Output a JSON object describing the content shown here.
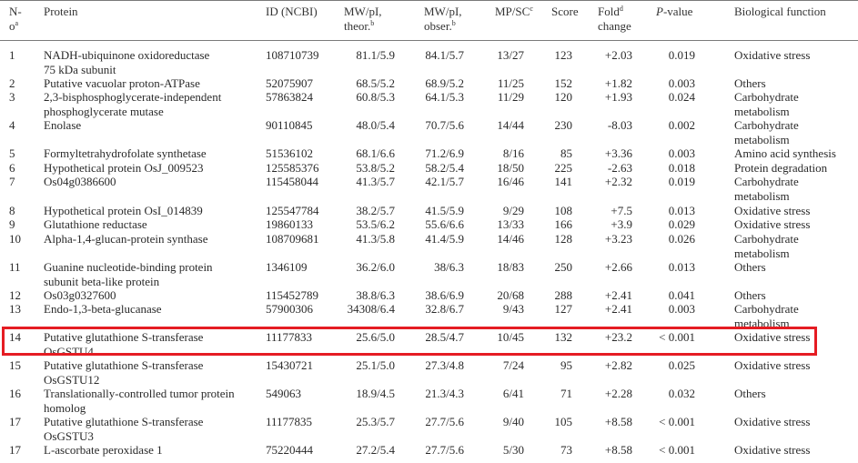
{
  "headers": {
    "no_line1": "N-",
    "no_line2": "o",
    "no_sup": "a",
    "protein": "Protein",
    "id": "ID (NCBI)",
    "mw_theor_line1": "MW/pI,",
    "mw_theor_line2": "theor.",
    "mw_theor_sup": "b",
    "mw_obser_line1": "MW/pI,",
    "mw_obser_line2": "obser.",
    "mw_obser_sup": "b",
    "mp_sc": "MP/SC",
    "mp_sc_sup": "c",
    "score": "Score",
    "fold_line1": "Fold",
    "fold_sup": "d",
    "fold_line2": "change",
    "pvalue_p": "P",
    "pvalue_rest": "-value",
    "bio": "Biological function"
  },
  "rows": [
    {
      "no": "1",
      "protein": [
        "NADH-ubiquinone oxidoreductase",
        "75 kDa subunit"
      ],
      "id": "108710739",
      "mw_theor": "81.1/5.9",
      "mw_obser": "84.1/5.7",
      "mp_sc": "13/27",
      "score": "123",
      "fold": "+2.03",
      "pvalue": "0.019",
      "bio": [
        "Oxidative stress"
      ]
    },
    {
      "no": "2",
      "protein": [
        "Putative vacuolar proton-ATPase"
      ],
      "id": "52075907",
      "mw_theor": "68.5/5.2",
      "mw_obser": "68.9/5.2",
      "mp_sc": "11/25",
      "score": "152",
      "fold": "+1.82",
      "pvalue": "0.003",
      "bio": [
        "Others"
      ]
    },
    {
      "no": "3",
      "protein": [
        "2,3-bisphosphoglycerate-independent",
        "phosphoglycerate mutase"
      ],
      "id": "57863824",
      "mw_theor": "60.8/5.3",
      "mw_obser": "64.1/5.3",
      "mp_sc": "11/29",
      "score": "120",
      "fold": "+1.93",
      "pvalue": "0.024",
      "bio": [
        "Carbohydrate",
        "metabolism"
      ]
    },
    {
      "no": "4",
      "protein": [
        "Enolase"
      ],
      "id": "90110845",
      "mw_theor": "48.0/5.4",
      "mw_obser": "70.7/5.6",
      "mp_sc": "14/44",
      "score": "230",
      "fold": "-8.03",
      "pvalue": "0.002",
      "bio": [
        "Carbohydrate",
        "metabolism"
      ]
    },
    {
      "no": "5",
      "protein": [
        "Formyltetrahydrofolate synthetase"
      ],
      "id": "51536102",
      "mw_theor": "68.1/6.6",
      "mw_obser": "71.2/6.9",
      "mp_sc": "8/16",
      "score": "85",
      "fold": "+3.36",
      "pvalue": "0.003",
      "bio": [
        "Amino acid synthesis"
      ]
    },
    {
      "no": "6",
      "protein": [
        "Hypothetical protein OsJ_009523"
      ],
      "id": "125585376",
      "mw_theor": "53.8/5.2",
      "mw_obser": "58.2/5.4",
      "mp_sc": "18/50",
      "score": "225",
      "fold": "-2.63",
      "pvalue": "0.018",
      "bio": [
        "Protein degradation"
      ]
    },
    {
      "no": "7",
      "protein": [
        "Os04g0386600"
      ],
      "id": "115458044",
      "mw_theor": "41.3/5.7",
      "mw_obser": "42.1/5.7",
      "mp_sc": "16/46",
      "score": "141",
      "fold": "+2.32",
      "pvalue": "0.019",
      "bio": [
        "Carbohydrate",
        "metabolism"
      ]
    },
    {
      "no": "8",
      "protein": [
        "Hypothetical protein OsI_014839"
      ],
      "id": "125547784",
      "mw_theor": "38.2/5.7",
      "mw_obser": "41.5/5.9",
      "mp_sc": "9/29",
      "score": "108",
      "fold": "+7.5",
      "pvalue": "0.013",
      "bio": [
        "Oxidative stress"
      ]
    },
    {
      "no": "9",
      "protein": [
        "Glutathione reductase"
      ],
      "id": "19860133",
      "mw_theor": "53.5/6.2",
      "mw_obser": "55.6/6.6",
      "mp_sc": "13/33",
      "score": "166",
      "fold": "+3.9",
      "pvalue": "0.029",
      "bio": [
        "Oxidative stress"
      ]
    },
    {
      "no": "10",
      "protein": [
        "Alpha-1,4-glucan-protein synthase"
      ],
      "id": "108709681",
      "mw_theor": "41.3/5.8",
      "mw_obser": "41.4/5.9",
      "mp_sc": "14/46",
      "score": "128",
      "fold": "+3.23",
      "pvalue": "0.026",
      "bio": [
        "Carbohydrate",
        "metabolism"
      ]
    },
    {
      "no": "11",
      "protein": [
        "Guanine nucleotide-binding protein",
        "subunit beta-like protein"
      ],
      "id": "1346109",
      "mw_theor": "36.2/6.0",
      "mw_obser": "38/6.3",
      "mp_sc": "18/83",
      "score": "250",
      "fold": "+2.66",
      "pvalue": "0.013",
      "bio": [
        "Others"
      ]
    },
    {
      "no": "12",
      "protein": [
        "Os03g0327600"
      ],
      "id": "115452789",
      "mw_theor": "38.8/6.3",
      "mw_obser": "38.6/6.9",
      "mp_sc": "20/68",
      "score": "288",
      "fold": "+2.41",
      "pvalue": "0.041",
      "bio": [
        "Others"
      ]
    },
    {
      "no": "13",
      "protein": [
        "Endo-1,3-beta-glucanase"
      ],
      "id": "57900306",
      "mw_theor": "34308/6.4",
      "mw_obser": "32.8/6.7",
      "mp_sc": "9/43",
      "score": "127",
      "fold": "+2.41",
      "pvalue": "0.003",
      "bio": [
        "Carbohydrate",
        "metabolism"
      ]
    },
    {
      "no": "14",
      "protein": [
        "Putative glutathione S-transferase",
        "OsGSTU4"
      ],
      "id": "11177833",
      "mw_theor": "25.6/5.0",
      "mw_obser": "28.5/4.7",
      "mp_sc": "10/45",
      "score": "132",
      "fold": "+23.2",
      "pvalue": "< 0.001",
      "bio": [
        "Oxidative stress"
      ]
    },
    {
      "no": "15",
      "protein": [
        "Putative glutathione S-transferase",
        "OsGSTU12"
      ],
      "id": "15430721",
      "mw_theor": "25.1/5.0",
      "mw_obser": "27.3/4.8",
      "mp_sc": "7/24",
      "score": "95",
      "fold": "+2.82",
      "pvalue": "0.025",
      "bio": [
        "Oxidative stress"
      ]
    },
    {
      "no": "16",
      "protein": [
        "Translationally-controlled tumor protein",
        "homolog"
      ],
      "id": "549063",
      "mw_theor": "18.9/4.5",
      "mw_obser": "21.3/4.3",
      "mp_sc": "6/41",
      "score": "71",
      "fold": "+2.28",
      "pvalue": "0.032",
      "bio": [
        "Others"
      ]
    },
    {
      "no": "17",
      "protein": [
        "Putative glutathione S-transferase",
        "OsGSTU3"
      ],
      "id": "11177835",
      "mw_theor": "25.3/5.7",
      "mw_obser": "27.7/5.6",
      "mp_sc": "9/40",
      "score": "105",
      "fold": "+8.58",
      "pvalue": "< 0.001",
      "bio": [
        "Oxidative stress"
      ]
    },
    {
      "no": "17",
      "protein": [
        "L-ascorbate peroxidase 1"
      ],
      "id": "75220444",
      "mw_theor": "27.2/5.4",
      "mw_obser": "27.7/5.6",
      "mp_sc": "5/30",
      "score": "73",
      "fold": "+8.58",
      "pvalue": "< 0.001",
      "bio": [
        "Oxidative stress"
      ]
    }
  ],
  "highlight_color": "#e51c23"
}
